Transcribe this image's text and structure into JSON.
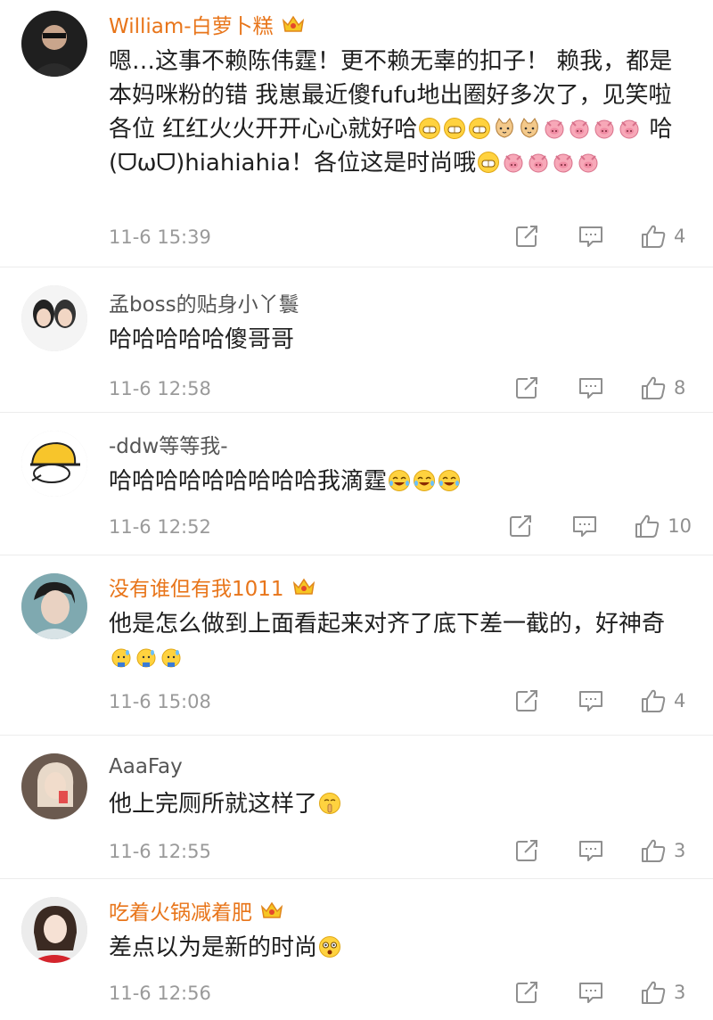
{
  "comments": [
    {
      "username": "William-白萝卜糕",
      "vip": true,
      "text_parts": [
        "嗯…这事不赖陈伟霆！更不赖无辜的扣子！ 赖我，都是本妈咪粉的错 我崽最近傻fufu地出圈好多次了，见笑啦各位 红红火火开开心心就好哈",
        " 哈(ᗜωᗜ)hiahiahia！各位这是时尚哦"
      ],
      "time": "11-6 15:39",
      "likes": "4"
    },
    {
      "username": "孟boss的贴身小丫鬟",
      "vip": false,
      "text_parts": [
        "哈哈哈哈哈傻哥哥"
      ],
      "time": "11-6 12:58",
      "likes": "8"
    },
    {
      "username": "-ddw等等我-",
      "vip": false,
      "text_parts": [
        "哈哈哈哈哈哈哈哈哈我滴霆"
      ],
      "time": "11-6 12:52",
      "likes": "10"
    },
    {
      "username": "没有谁但有我1011",
      "vip": true,
      "text_parts": [
        "他是怎么做到上面看起来对齐了底下差一截的，好神奇"
      ],
      "time": "11-6 15:08",
      "likes": "4"
    },
    {
      "username": "AaaFay",
      "vip": false,
      "text_parts": [
        "他上完厕所就这样了"
      ],
      "time": "11-6 12:55",
      "likes": "3"
    },
    {
      "username": "吃着火锅减着肥",
      "vip": true,
      "text_parts": [
        "差点以为是新的时尚"
      ],
      "time": "11-6 12:56",
      "likes": "3"
    }
  ],
  "icons": {
    "share": "share-icon",
    "reply": "reply-icon",
    "like": "thumbs-up-icon",
    "vip": "crown-icon"
  },
  "colors": {
    "vip_name": "#e8751a",
    "plain_name": "#555555",
    "meta": "#9a9a9a"
  }
}
